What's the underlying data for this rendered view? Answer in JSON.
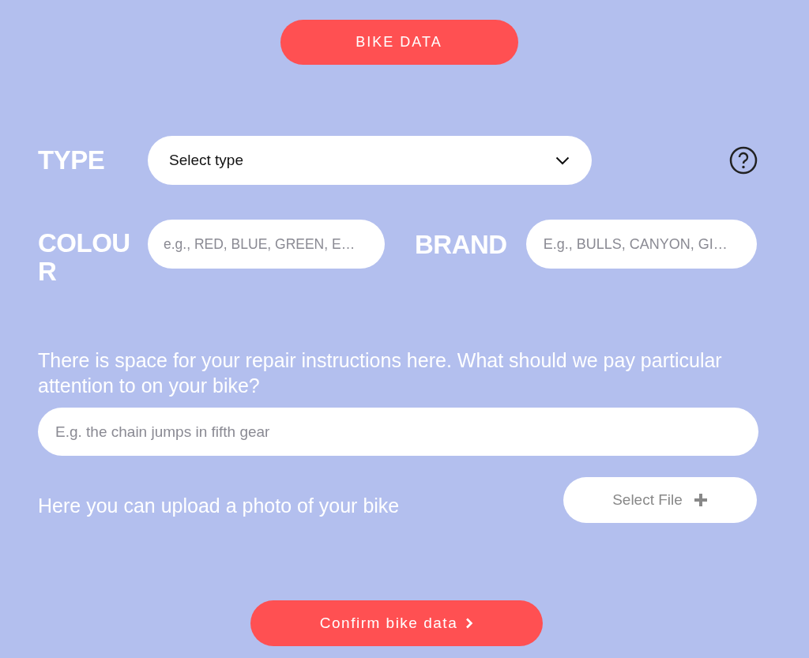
{
  "header_button": {
    "label": "BIKE DATA"
  },
  "type": {
    "label": "TYPE",
    "select": {
      "value": "Select type"
    }
  },
  "colour": {
    "label": "COLOUR",
    "placeholder": "e.g., RED, BLUE, GREEN, E…"
  },
  "brand": {
    "label": "BRAND",
    "placeholder": "E.g., BULLS, CANYON, GI…"
  },
  "instructions": {
    "prompt": "There is space for your repair instructions here. What should we pay particular attention to on your bike?",
    "placeholder": "E.g. the chain jumps in fifth gear"
  },
  "upload": {
    "prompt": "Here you can upload a photo of your bike",
    "button": "Select File"
  },
  "confirm_button": {
    "label": "Confirm bike data"
  }
}
